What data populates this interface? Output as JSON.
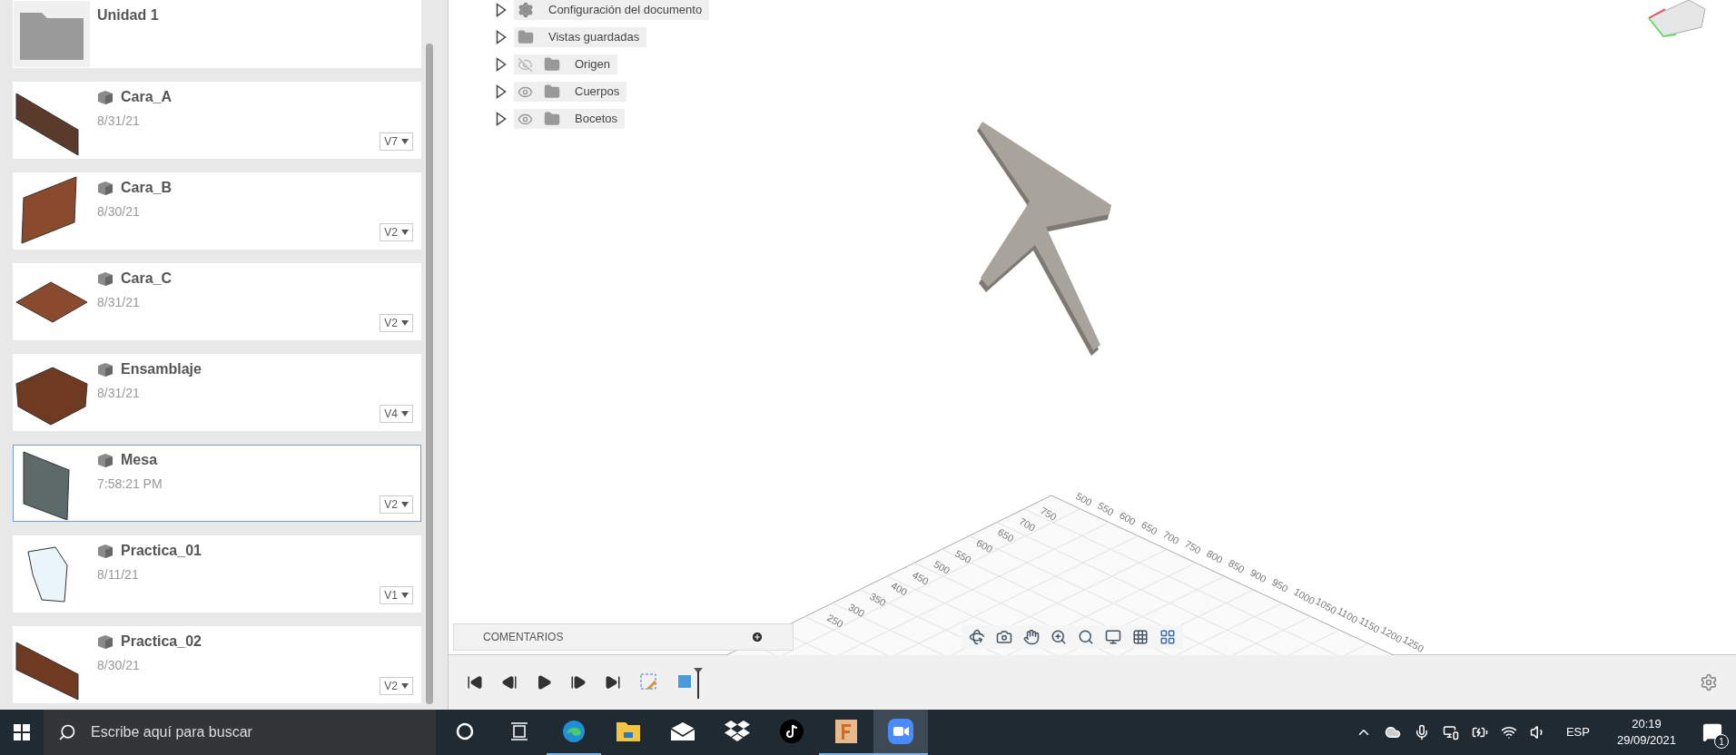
{
  "sidebar": {
    "items": [
      {
        "kind": "folder",
        "name": "Unidad 1",
        "selected": false
      },
      {
        "kind": "design",
        "name": "Cara_A",
        "date": "8/31/21",
        "version": "V7",
        "selected": false
      },
      {
        "kind": "design",
        "name": "Cara_B",
        "date": "8/30/21",
        "version": "V2",
        "selected": false
      },
      {
        "kind": "design",
        "name": "Cara_C",
        "date": "8/31/21",
        "version": "V2",
        "selected": false
      },
      {
        "kind": "design",
        "name": "Ensamblaje",
        "date": "8/31/21",
        "version": "V4",
        "selected": false
      },
      {
        "kind": "design",
        "name": "Mesa",
        "date": "7:58:21 PM",
        "version": "V2",
        "selected": true
      },
      {
        "kind": "design",
        "name": "Practica_01",
        "date": "8/11/21",
        "version": "V1",
        "selected": false
      },
      {
        "kind": "design",
        "name": "Practica_02",
        "date": "8/30/21",
        "version": "V2",
        "selected": false
      }
    ]
  },
  "browser_tree": [
    {
      "kind": "settings",
      "label": "Configuración del documento"
    },
    {
      "kind": "folder",
      "label": "Vistas guardadas"
    },
    {
      "kind": "layer",
      "label": "Origen",
      "visible": false
    },
    {
      "kind": "layer",
      "label": "Cuerpos",
      "visible": true
    },
    {
      "kind": "layer",
      "label": "Bocetos",
      "visible": true
    }
  ],
  "grid": {
    "left_labels": [
      "250",
      "300",
      "350",
      "400",
      "450",
      "500",
      "550",
      "600",
      "650",
      "700",
      "750"
    ],
    "right_labels": [
      "500",
      "550",
      "600",
      "650",
      "700",
      "750",
      "800",
      "850",
      "900",
      "950",
      "1000",
      "1050",
      "1100",
      "1150",
      "1200",
      "1250"
    ]
  },
  "comments": {
    "title": "COMENTARIOS"
  },
  "taskbar": {
    "search_placeholder": "Escribe aquí para buscar",
    "apps": [
      {
        "kind": "cortana",
        "running": false,
        "selected": false
      },
      {
        "kind": "task-view",
        "running": false,
        "selected": false
      },
      {
        "kind": "edge",
        "running": true,
        "selected": false
      },
      {
        "kind": "explorer",
        "running": false,
        "selected": false
      },
      {
        "kind": "mail",
        "running": false,
        "selected": false
      },
      {
        "kind": "dropbox",
        "running": false,
        "selected": false
      },
      {
        "kind": "tiktok",
        "running": false,
        "selected": false
      },
      {
        "kind": "fusion",
        "running": true,
        "selected": false
      },
      {
        "kind": "zoom",
        "running": true,
        "selected": true
      }
    ]
  },
  "tray": {
    "language": "ESP",
    "time": "20:19",
    "date": "29/09/2021",
    "notifications": "1"
  }
}
